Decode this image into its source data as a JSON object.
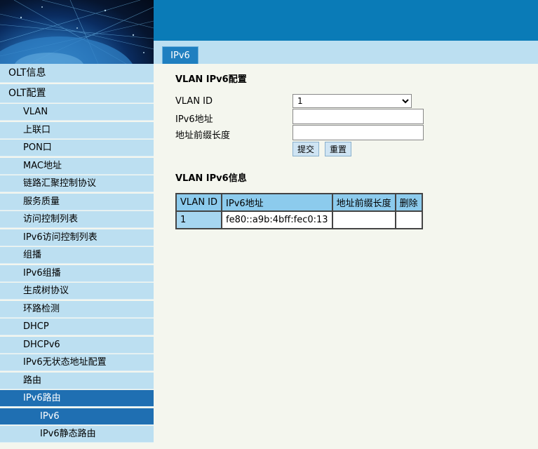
{
  "header": {
    "tab_label": "IPv6"
  },
  "sidebar": {
    "items": [
      {
        "label": "OLT信息",
        "level": "top",
        "active": false
      },
      {
        "label": "OLT配置",
        "level": "top",
        "active": false
      },
      {
        "label": "VLAN",
        "level": "sub",
        "active": false
      },
      {
        "label": "上联口",
        "level": "sub",
        "active": false
      },
      {
        "label": "PON口",
        "level": "sub",
        "active": false
      },
      {
        "label": "MAC地址",
        "level": "sub",
        "active": false
      },
      {
        "label": "链路汇聚控制协议",
        "level": "sub",
        "active": false
      },
      {
        "label": "服务质量",
        "level": "sub",
        "active": false
      },
      {
        "label": "访问控制列表",
        "level": "sub",
        "active": false
      },
      {
        "label": "IPv6访问控制列表",
        "level": "sub",
        "active": false
      },
      {
        "label": "组播",
        "level": "sub",
        "active": false
      },
      {
        "label": "IPv6组播",
        "level": "sub",
        "active": false
      },
      {
        "label": "生成树协议",
        "level": "sub",
        "active": false
      },
      {
        "label": "环路检测",
        "level": "sub",
        "active": false
      },
      {
        "label": "DHCP",
        "level": "sub",
        "active": false
      },
      {
        "label": "DHCPv6",
        "level": "sub",
        "active": false
      },
      {
        "label": "IPv6无状态地址配置",
        "level": "sub",
        "active": false
      },
      {
        "label": "路由",
        "level": "sub",
        "active": false
      },
      {
        "label": "IPv6路由",
        "level": "sub",
        "active": true
      },
      {
        "label": "IPv6",
        "level": "sub2",
        "active": true
      },
      {
        "label": "IPv6静态路由",
        "level": "sub2",
        "active": false
      }
    ]
  },
  "config": {
    "title": "VLAN IPv6配置",
    "vlan_id_label": "VLAN ID",
    "vlan_id_value": "1",
    "ipv6_addr_label": "IPv6地址",
    "ipv6_addr_value": "",
    "prefix_label": "地址前缀长度",
    "prefix_value": "",
    "submit_label": "提交",
    "reset_label": "重置"
  },
  "info": {
    "title": "VLAN IPv6信息",
    "columns": [
      "VLAN ID",
      "IPv6地址",
      "地址前缀长度",
      "删除"
    ],
    "rows": [
      [
        "1",
        "fe80::a9b:4bff:fec0:13",
        "",
        ""
      ]
    ]
  }
}
